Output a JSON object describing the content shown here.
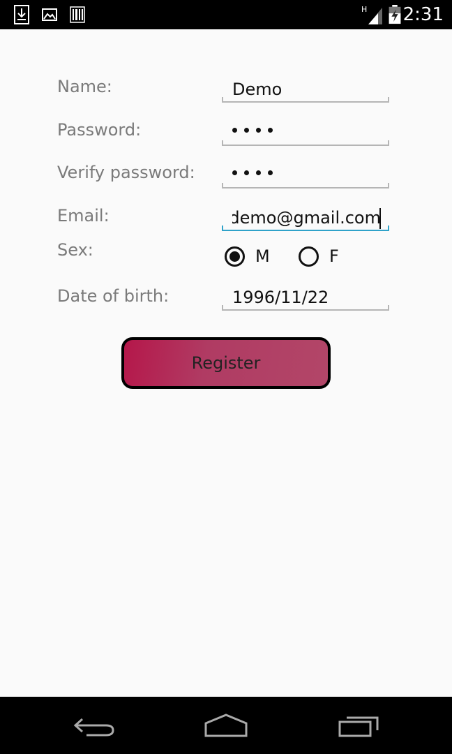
{
  "status_bar": {
    "time": "2:31",
    "network": "H",
    "icons": [
      "download-icon",
      "image-icon",
      "barcode-icon",
      "signal-icon",
      "battery-icon"
    ]
  },
  "form": {
    "name": {
      "label": "Name:",
      "value": "Demo"
    },
    "password": {
      "label": "Password:",
      "masked_count": 4
    },
    "verify_password": {
      "label": "Verify password:",
      "masked_count": 4
    },
    "email": {
      "label": "Email:",
      "value": "demo@gmail.com"
    },
    "sex": {
      "label": "Sex:",
      "options": [
        {
          "label": "M",
          "checked": true
        },
        {
          "label": "F",
          "checked": false
        }
      ]
    },
    "date_of_birth": {
      "label": "Date of birth:",
      "value": "1996/11/22"
    }
  },
  "register_button": {
    "label": "Register"
  },
  "nav_bar": {
    "icons": [
      "back-icon",
      "home-icon",
      "recents-icon"
    ]
  },
  "colors": {
    "focus_accent": "#2fa2c9",
    "button_start": "#b5174a",
    "button_end": "#b24668"
  }
}
